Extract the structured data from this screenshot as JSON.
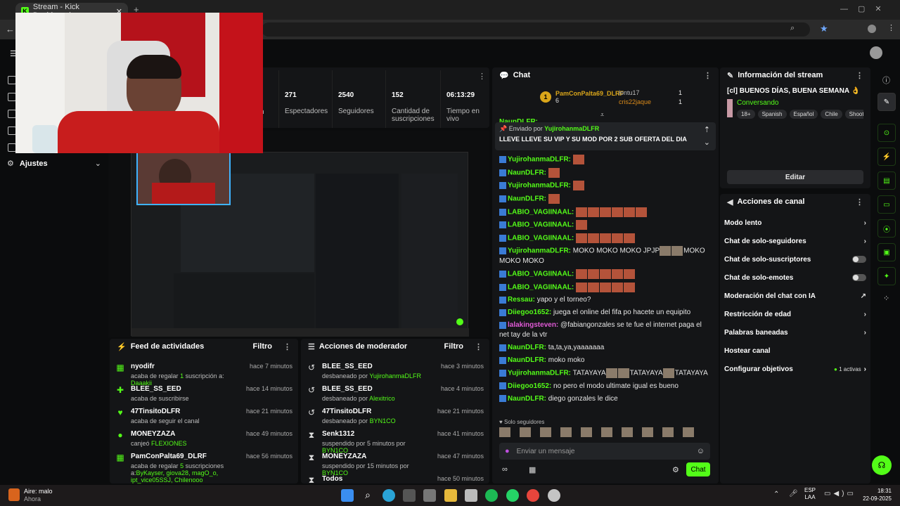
{
  "browser": {
    "tab_title": "Stream - Kick Dashboard"
  },
  "stats": [
    {
      "value": "271",
      "label": "Espectadores"
    },
    {
      "value": "2540",
      "label": "Seguidores"
    },
    {
      "value": "152",
      "label": "Cantidad de suscripciones"
    },
    {
      "value": "06:13:29",
      "label": "Tiempo en vivo"
    }
  ],
  "stats_partial": "n",
  "sidebar": {
    "settings_label": "Ajustes"
  },
  "activity_feed": {
    "title": "Feed de actividades",
    "filter": "Filtro",
    "items": [
      {
        "name": "nyodifr",
        "desc_prefix": "acaba de regalar ",
        "desc_count": "1",
        "desc_mid": " suscripción a: ",
        "desc_target": "Daaakii",
        "time": "hace 7 minutos"
      },
      {
        "name": "BLEE_SS_EED",
        "desc_prefix": "acaba de suscribirse",
        "desc_count": "",
        "desc_mid": "",
        "desc_target": "",
        "time": "hace 14 minutos"
      },
      {
        "name": "47TinsitoDLFR",
        "desc_prefix": "acaba de seguir el canal",
        "desc_count": "",
        "desc_mid": "",
        "desc_target": "",
        "time": "hace 21 minutos"
      },
      {
        "name": "MONEYZAZA",
        "desc_prefix": "canjeó ",
        "desc_count": "",
        "desc_mid": "",
        "desc_target": "FLEXIONES",
        "time": "hace 49 minutos"
      },
      {
        "name": "PamConPalta69_DLRF",
        "desc_prefix": "acaba de regalar ",
        "desc_count": "5",
        "desc_mid": " suscripciones a:",
        "desc_target": "ByKayser, giova28, magO_o, ipt_vice05SSJ, Chilenooo",
        "time": "hace 56 minutos"
      }
    ]
  },
  "mod_actions": {
    "title": "Acciones de moderador",
    "filter": "Filtro",
    "items": [
      {
        "name": "BLEE_SS_EED",
        "desc": "desbaneado por ",
        "by": "YujirohanmaDLFR",
        "time": "hace 3 minutos"
      },
      {
        "name": "BLEE_SS_EED",
        "desc": "desbaneado por ",
        "by": "Alexitrico",
        "time": "hace 4 minutos"
      },
      {
        "name": "47TinsitoDLFR",
        "desc": "desbaneado por ",
        "by": "BYN1CO",
        "time": "hace 21 minutos"
      },
      {
        "name": "Senk1312",
        "desc": "suspendido por 5 minutos por ",
        "by": "BYN1CO",
        "time": "hace 41 minutos"
      },
      {
        "name": "MONEYZAZA",
        "desc": "suspendido por 15 minutos por ",
        "by": "BYN1CO",
        "time": "hace 47 minutos"
      },
      {
        "name": "Todos",
        "desc": "",
        "by": "",
        "time": "hace 50 minutos"
      }
    ]
  },
  "chat": {
    "title": "Chat",
    "top_gifter": {
      "name": "PamConPalta69_DLRF",
      "count": "6"
    },
    "side_gifters": [
      {
        "name": "lontu17",
        "count": "1"
      },
      {
        "name": "cris22jaque",
        "count": "1"
      }
    ],
    "pinned_by_label": "Enviado por",
    "pinned_by": "YujirohanmaDLFR",
    "pinned_msg": "LLEVE LLEVE SU VIP Y SU MOD POR 2 SUB OFERTA DEL DIA",
    "partial_top": "NaunDLFR:",
    "messages": [
      {
        "user": "YujirohanmaDLFR:",
        "text": "",
        "emotes": 1
      },
      {
        "user": "NaunDLFR:",
        "text": "",
        "emotes": 1
      },
      {
        "user": "YujirohanmaDLFR:",
        "text": "",
        "emotes": 1
      },
      {
        "user": "NaunDLFR:",
        "text": "",
        "emotes": 1
      },
      {
        "user": "LABIO_VAGIINAAL:",
        "text": "",
        "emotes": 6
      },
      {
        "user": "LABIO_VAGIINAAL:",
        "text": "",
        "emotes": 1
      },
      {
        "user": "LABIO_VAGIINAAL:",
        "text": "",
        "emotes": 5
      },
      {
        "user": "YujirohanmaDLFR:",
        "text": "MOKO MOKO MOKO JPJP",
        "text2": "MOKO MOKO MOKO",
        "emotes": 0
      },
      {
        "user": "LABIO_VAGIINAAL:",
        "text": "",
        "emotes": 5
      },
      {
        "user": "LABIO_VAGIINAAL:",
        "text": "",
        "emotes": 5
      },
      {
        "user": "Ressau:",
        "text": "yapo y el torneo?",
        "emotes": 0
      },
      {
        "user": "Diiegoo1652:",
        "text": "juega el online del fifa po hacete un equipito",
        "emotes": 0
      },
      {
        "user": "lalakingsteven:",
        "text": "@fabiangonzales se te fue el internet paga el net tay de la vtr",
        "emotes": 0
      },
      {
        "user": "NaunDLFR:",
        "text": "ta,ta,ya,yaaaaaaa",
        "emotes": 0
      },
      {
        "user": "NaunDLFR:",
        "text": "moko moko",
        "emotes": 0
      },
      {
        "user": "YujirohanmaDLFR:",
        "text": "TATAYAYA",
        "text2": "TATAYAYA",
        "text3": "TATAYAYA",
        "emotes": 0
      },
      {
        "user": "Diiegoo1652:",
        "text": "no pero el modo ultimate igual es bueno",
        "emotes": 0
      },
      {
        "user": "NaunDLFR:",
        "text": "diego gonzales le dice",
        "emotes": 0
      }
    ],
    "followers_only": "Solo seguidores",
    "input_placeholder": "Enviar un mensaje",
    "send_label": "Chat"
  },
  "stream_info": {
    "title": "Información del stream",
    "stream_title": "[cl] BUENOS DÍAS, BUENA SEMANA 👌",
    "category": "Conversando",
    "tags": [
      "18+",
      "Spanish",
      "Español",
      "Chile",
      "Shoote"
    ],
    "edit_label": "Editar"
  },
  "channel_actions": {
    "title": "Acciones de canal",
    "items": [
      {
        "label": "Modo lento",
        "control": "chevron"
      },
      {
        "label": "Chat de solo-seguidores",
        "control": "chevron"
      },
      {
        "label": "Chat de solo-suscriptores",
        "control": "toggle"
      },
      {
        "label": "Chat de solo-emotes",
        "control": "toggle"
      },
      {
        "label": "Moderación del chat con IA",
        "control": "external"
      },
      {
        "label": "Restricción de edad",
        "control": "chevron"
      },
      {
        "label": "Palabras baneadas",
        "control": "chevron"
      },
      {
        "label": "Hostear canal",
        "control": "none"
      },
      {
        "label": "Configurar objetivos",
        "control": "goals"
      }
    ],
    "goals_status": "1 activas"
  },
  "taskbar": {
    "weather": "Aire: malo",
    "weather_sub": "Ahora",
    "lang": "ESP",
    "lang_sub": "LAA",
    "time": "18:31",
    "date": "22-09-2025"
  },
  "colors": {
    "accent": "#53fc18",
    "bg": "#0b0c0d",
    "panel": "#141517"
  }
}
